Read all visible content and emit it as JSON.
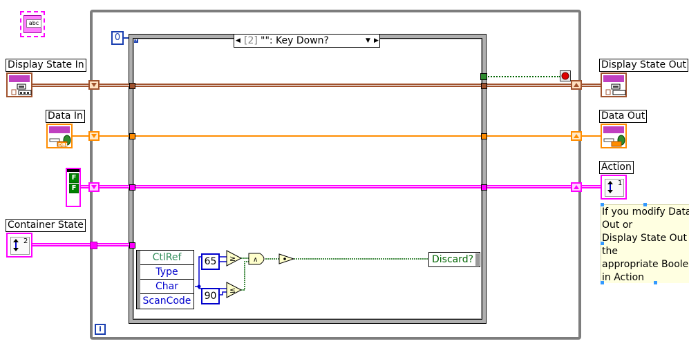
{
  "terminals": {
    "display_state_in": "Display State In",
    "data_in": "Data In",
    "container_state": "Container State",
    "display_state_out": "Display State Out",
    "data_out": "Data Out",
    "action": "Action"
  },
  "loop": {
    "count_terminal": "0",
    "iteration_terminal": "i"
  },
  "case_selector": {
    "index": "[2]",
    "label": "\"\": Key Down?"
  },
  "event_data": {
    "items": [
      "CtlRef",
      "Type",
      "Char",
      "ScanCode"
    ]
  },
  "constants": {
    "low": "65",
    "high": "90"
  },
  "indicator": {
    "discard_label": "Discard?"
  },
  "boolean_consts": [
    "F",
    "F"
  ],
  "comment": {
    "lines": [
      "If you modify Data",
      "Out or",
      "Display State Out s",
      "the",
      "appropriate Boolea",
      "in Action"
    ]
  },
  "icon_text": {
    "string_icon": "abc",
    "dbl_icon": "DBL",
    "cluster_index": "2",
    "action_index": "1"
  },
  "colors": {
    "display_wire": "#a0522d",
    "data_wire": "#ff8c00",
    "bool_wire": "#ff00ff",
    "numeric_blue": "#0000cc",
    "loop_gray": "#7d7d7d",
    "bool_green": "#006400"
  }
}
